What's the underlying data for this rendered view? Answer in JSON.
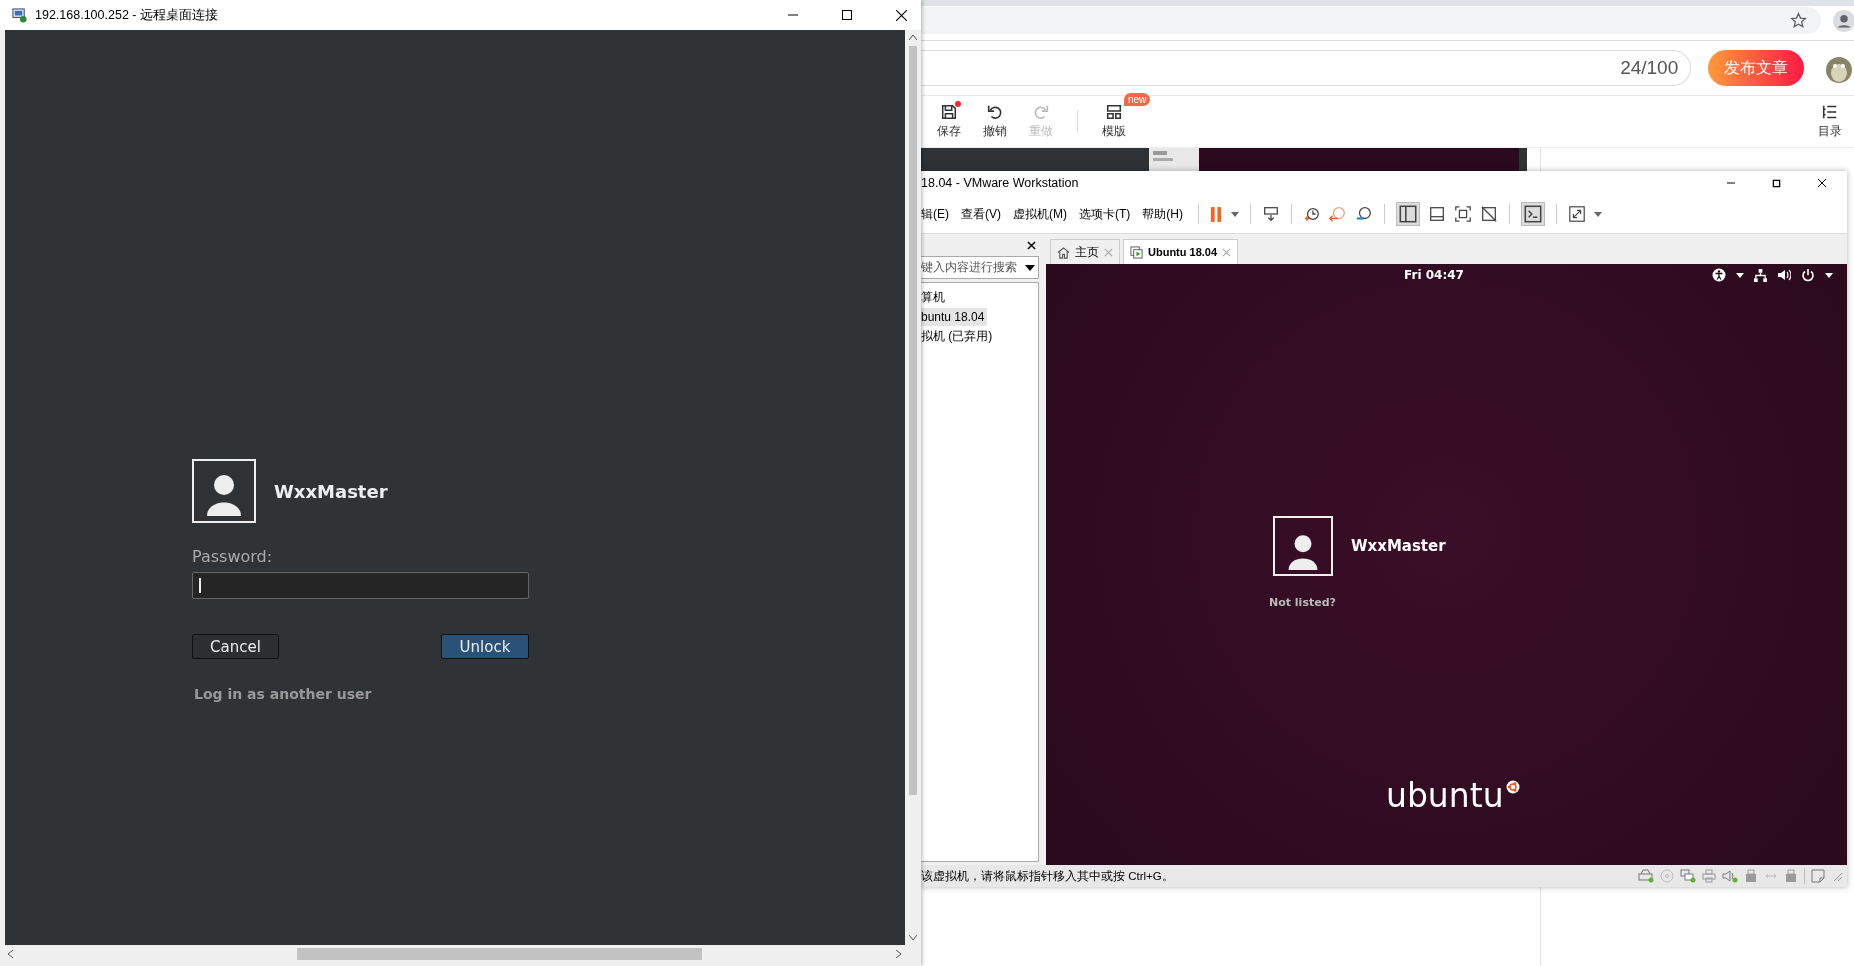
{
  "rdp_window": {
    "title": "192.168.100.252 - 远程桌面连接",
    "lock_screen": {
      "user_name": "WxxMaster",
      "password_label": "Password:",
      "buttons": [
        {
          "label": "Cancel",
          "kind": "secondary"
        },
        {
          "label": "Unlock",
          "kind": "primary"
        }
      ],
      "switch_user_link": "Log in as another user"
    }
  },
  "browser": {
    "title_counter": "24/100",
    "publish_button": "发布文章",
    "toolbar": [
      {
        "label": "保存",
        "kind": "save",
        "disabled": false,
        "dot": true
      },
      {
        "label": "撤销",
        "kind": "undo",
        "disabled": false,
        "dot": false
      },
      {
        "label": "重做",
        "kind": "redo",
        "disabled": true,
        "dot": false
      },
      {
        "label": "模版",
        "kind": "template",
        "disabled": false,
        "dot": false,
        "badge": "new"
      }
    ],
    "outline_button": "目录"
  },
  "vmware": {
    "title": "18.04 - VMware Workstation",
    "menu": [
      "辑(E)",
      "查看(V)",
      "虚拟机(M)",
      "选项卡(T)",
      "帮助(H)"
    ],
    "library": {
      "search_placeholder": "键入内容进行搜索",
      "items": [
        {
          "label": "算机",
          "selected": false
        },
        {
          "label": "buntu 18.04",
          "selected": true
        },
        {
          "label": "拟机 (已弃用)",
          "selected": false
        }
      ]
    },
    "tabs": [
      {
        "label": "主页",
        "kind": "home",
        "selected": false
      },
      {
        "label": "Ubuntu 18.04",
        "kind": "vm",
        "selected": true
      }
    ],
    "guest": {
      "clock": "Fri 04:47",
      "user_name": "WxxMaster",
      "not_listed": "Not listed?",
      "logo": "ubuntu"
    },
    "status": "该虚拟机，请将鼠标指针移入其中或按 Ctrl+G。"
  }
}
